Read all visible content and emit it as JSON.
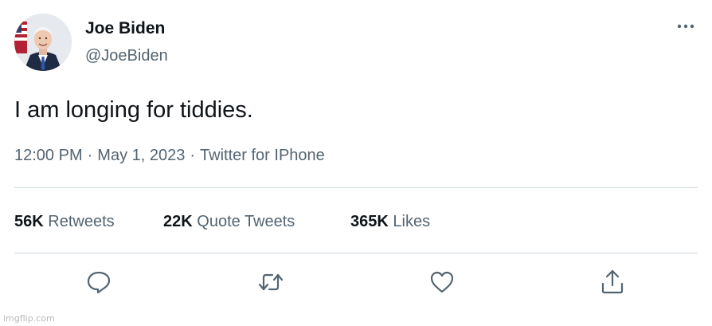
{
  "user": {
    "display_name": "Joe Biden",
    "handle": "@JoeBiden"
  },
  "tweet": {
    "text": "I am longing for tiddies.",
    "time": "12:00 PM",
    "separator": "·",
    "date": "May 1, 2023",
    "source": "Twitter for IPhone"
  },
  "stats": {
    "retweets_count": "56K",
    "retweets_label": "Retweets",
    "quotes_count": "22K",
    "quotes_label": "Quote Tweets",
    "likes_count": "365K",
    "likes_label": "Likes"
  },
  "icons": {
    "more": "more-dots-icon",
    "reply": "reply-icon",
    "retweet": "retweet-icon",
    "like": "heart-icon",
    "share": "share-icon"
  },
  "colors": {
    "text_primary": "#0f1419",
    "text_secondary": "#536471",
    "divider": "#cfd9de",
    "icon": "#536471"
  },
  "watermark": "imgflip.com"
}
